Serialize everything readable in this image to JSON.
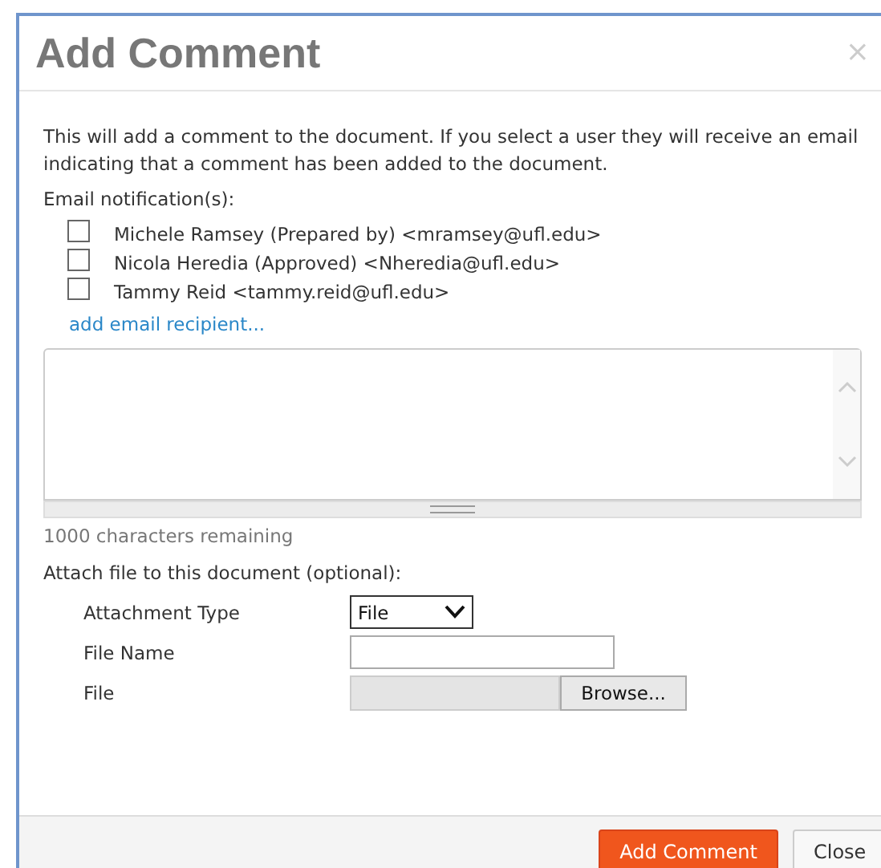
{
  "dialog": {
    "title": "Add Comment",
    "close": "×"
  },
  "intro": "This will add a comment to the document. If you select a user they will receive an email indicating that a comment has been added to the document.",
  "notifications": {
    "label": "Email notification(s):",
    "recipients": [
      {
        "label": "Michele Ramsey (Prepared by) <mramsey@ufl.edu>",
        "checked": false
      },
      {
        "label": "Nicola Heredia (Approved) <Nheredia@ufl.edu>",
        "checked": false
      },
      {
        "label": "Tammy Reid <tammy.reid@ufl.edu>",
        "checked": false
      }
    ],
    "add_link": "add email recipient..."
  },
  "comment": {
    "remaining": "1000 characters remaining"
  },
  "attachment": {
    "label": "Attach file to this document (optional):",
    "fields": [
      {
        "kind": "select",
        "label": "Attachment Type",
        "value": "File"
      },
      {
        "kind": "text",
        "label": "File Name"
      },
      {
        "kind": "file",
        "label": "File",
        "button": "Browse..."
      }
    ]
  },
  "buttons": [
    {
      "label": "Add Comment",
      "primary": true
    },
    {
      "label": "Close",
      "primary": false
    }
  ]
}
